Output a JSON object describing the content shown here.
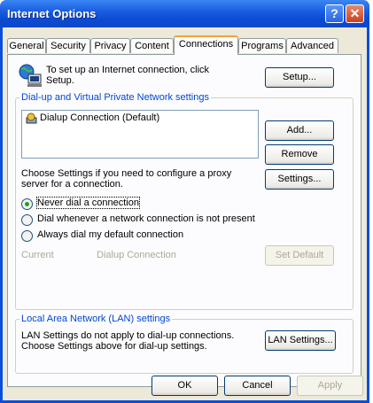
{
  "window": {
    "title": "Internet Options",
    "help_glyph": "?",
    "close_glyph": "✕"
  },
  "tabs": [
    {
      "label": "General"
    },
    {
      "label": "Security"
    },
    {
      "label": "Privacy"
    },
    {
      "label": "Content"
    },
    {
      "label": "Connections"
    },
    {
      "label": "Programs"
    },
    {
      "label": "Advanced"
    }
  ],
  "active_tab": "Connections",
  "setup": {
    "text_line1": "To set up an Internet connection, click",
    "text_line2": "Setup.",
    "button": "Setup..."
  },
  "dialup_group": {
    "legend": "Dial-up and Virtual Private Network settings",
    "items": [
      {
        "label": "Dialup Connection (Default)"
      }
    ],
    "add_button": "Add...",
    "remove_button": "Remove",
    "proxy_text_line1": "Choose Settings if you need to configure a proxy",
    "proxy_text_line2": "server for a connection.",
    "settings_button": "Settings..."
  },
  "dial_options": {
    "never": "Never dial a connection",
    "whenever": "Dial whenever a network connection is not present",
    "always": "Always dial my default connection",
    "selected": "never"
  },
  "current": {
    "label": "Current",
    "value": "Dialup Connection",
    "set_default_button": "Set Default"
  },
  "lan_group": {
    "legend": "Local Area Network (LAN) settings",
    "text_line1": "LAN Settings do not apply to dial-up connections.",
    "text_line2": "Choose Settings above for dial-up settings.",
    "button": "LAN Settings..."
  },
  "footer": {
    "ok": "OK",
    "cancel": "Cancel",
    "apply": "Apply"
  }
}
